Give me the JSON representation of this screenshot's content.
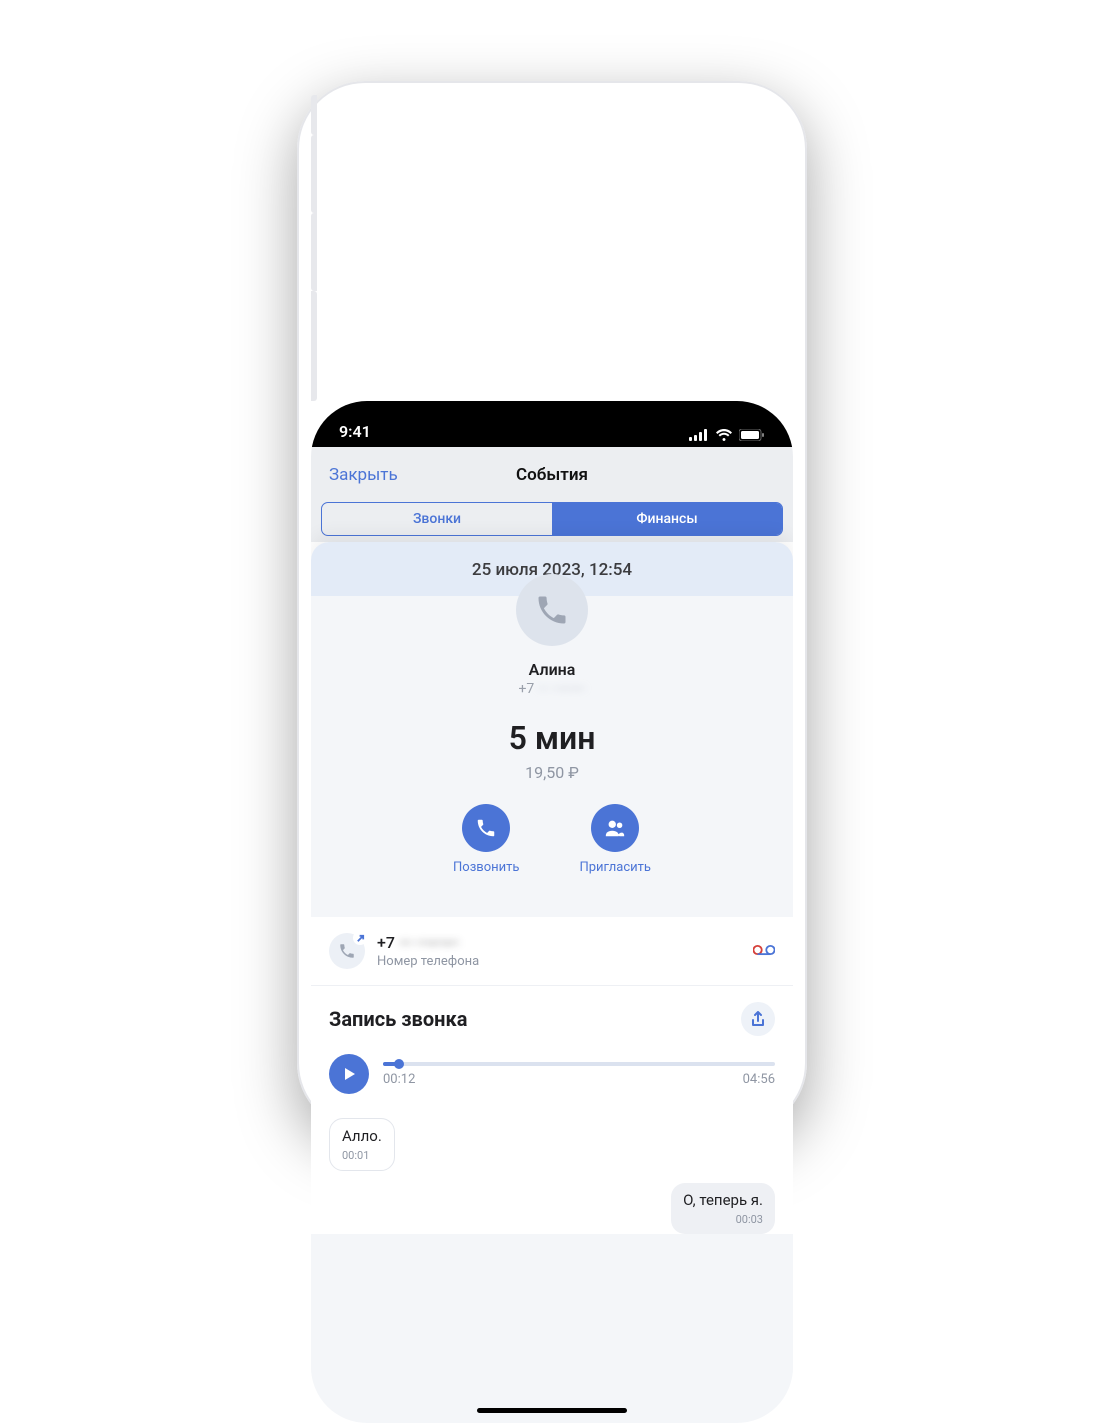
{
  "status_bar": {
    "time": "9:41"
  },
  "header": {
    "close": "Закрыть",
    "title": "События"
  },
  "tabs": [
    {
      "label": "Звонки",
      "active": false
    },
    {
      "label": "Финансы",
      "active": true
    }
  ],
  "event": {
    "datetime": "25 июля 2023, 12:54",
    "contact_name": "Алина",
    "contact_phone_prefix": "+7 ",
    "contact_phone_masked": "··· ···-··-··",
    "duration": "5 мин",
    "cost": "19,50 ₽"
  },
  "actions": {
    "call": "Позвонить",
    "invite": "Пригласить"
  },
  "number_row": {
    "phone_prefix": "+7 ",
    "phone_masked": "··· ···-··-··",
    "label": "Номер телефона"
  },
  "recording": {
    "title": "Запись звонка",
    "elapsed": "00:12",
    "total": "04:56",
    "progress_pct": 4
  },
  "transcript": [
    {
      "side": "in",
      "text": "Алло.",
      "time": "00:01"
    },
    {
      "side": "out",
      "text": "О, теперь я.",
      "time": "00:03"
    }
  ]
}
